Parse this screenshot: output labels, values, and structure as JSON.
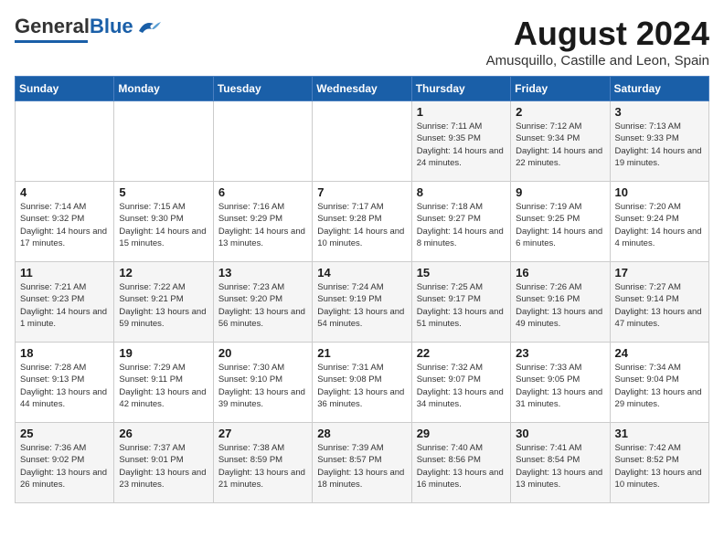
{
  "header": {
    "logo_general": "General",
    "logo_blue": "Blue",
    "month": "August 2024",
    "location": "Amusquillo, Castille and Leon, Spain"
  },
  "weekdays": [
    "Sunday",
    "Monday",
    "Tuesday",
    "Wednesday",
    "Thursday",
    "Friday",
    "Saturday"
  ],
  "weeks": [
    [
      {
        "day": "",
        "info": ""
      },
      {
        "day": "",
        "info": ""
      },
      {
        "day": "",
        "info": ""
      },
      {
        "day": "",
        "info": ""
      },
      {
        "day": "1",
        "info": "Sunrise: 7:11 AM\nSunset: 9:35 PM\nDaylight: 14 hours and 24 minutes."
      },
      {
        "day": "2",
        "info": "Sunrise: 7:12 AM\nSunset: 9:34 PM\nDaylight: 14 hours and 22 minutes."
      },
      {
        "day": "3",
        "info": "Sunrise: 7:13 AM\nSunset: 9:33 PM\nDaylight: 14 hours and 19 minutes."
      }
    ],
    [
      {
        "day": "4",
        "info": "Sunrise: 7:14 AM\nSunset: 9:32 PM\nDaylight: 14 hours and 17 minutes."
      },
      {
        "day": "5",
        "info": "Sunrise: 7:15 AM\nSunset: 9:30 PM\nDaylight: 14 hours and 15 minutes."
      },
      {
        "day": "6",
        "info": "Sunrise: 7:16 AM\nSunset: 9:29 PM\nDaylight: 14 hours and 13 minutes."
      },
      {
        "day": "7",
        "info": "Sunrise: 7:17 AM\nSunset: 9:28 PM\nDaylight: 14 hours and 10 minutes."
      },
      {
        "day": "8",
        "info": "Sunrise: 7:18 AM\nSunset: 9:27 PM\nDaylight: 14 hours and 8 minutes."
      },
      {
        "day": "9",
        "info": "Sunrise: 7:19 AM\nSunset: 9:25 PM\nDaylight: 14 hours and 6 minutes."
      },
      {
        "day": "10",
        "info": "Sunrise: 7:20 AM\nSunset: 9:24 PM\nDaylight: 14 hours and 4 minutes."
      }
    ],
    [
      {
        "day": "11",
        "info": "Sunrise: 7:21 AM\nSunset: 9:23 PM\nDaylight: 14 hours and 1 minute."
      },
      {
        "day": "12",
        "info": "Sunrise: 7:22 AM\nSunset: 9:21 PM\nDaylight: 13 hours and 59 minutes."
      },
      {
        "day": "13",
        "info": "Sunrise: 7:23 AM\nSunset: 9:20 PM\nDaylight: 13 hours and 56 minutes."
      },
      {
        "day": "14",
        "info": "Sunrise: 7:24 AM\nSunset: 9:19 PM\nDaylight: 13 hours and 54 minutes."
      },
      {
        "day": "15",
        "info": "Sunrise: 7:25 AM\nSunset: 9:17 PM\nDaylight: 13 hours and 51 minutes."
      },
      {
        "day": "16",
        "info": "Sunrise: 7:26 AM\nSunset: 9:16 PM\nDaylight: 13 hours and 49 minutes."
      },
      {
        "day": "17",
        "info": "Sunrise: 7:27 AM\nSunset: 9:14 PM\nDaylight: 13 hours and 47 minutes."
      }
    ],
    [
      {
        "day": "18",
        "info": "Sunrise: 7:28 AM\nSunset: 9:13 PM\nDaylight: 13 hours and 44 minutes."
      },
      {
        "day": "19",
        "info": "Sunrise: 7:29 AM\nSunset: 9:11 PM\nDaylight: 13 hours and 42 minutes."
      },
      {
        "day": "20",
        "info": "Sunrise: 7:30 AM\nSunset: 9:10 PM\nDaylight: 13 hours and 39 minutes."
      },
      {
        "day": "21",
        "info": "Sunrise: 7:31 AM\nSunset: 9:08 PM\nDaylight: 13 hours and 36 minutes."
      },
      {
        "day": "22",
        "info": "Sunrise: 7:32 AM\nSunset: 9:07 PM\nDaylight: 13 hours and 34 minutes."
      },
      {
        "day": "23",
        "info": "Sunrise: 7:33 AM\nSunset: 9:05 PM\nDaylight: 13 hours and 31 minutes."
      },
      {
        "day": "24",
        "info": "Sunrise: 7:34 AM\nSunset: 9:04 PM\nDaylight: 13 hours and 29 minutes."
      }
    ],
    [
      {
        "day": "25",
        "info": "Sunrise: 7:36 AM\nSunset: 9:02 PM\nDaylight: 13 hours and 26 minutes."
      },
      {
        "day": "26",
        "info": "Sunrise: 7:37 AM\nSunset: 9:01 PM\nDaylight: 13 hours and 23 minutes."
      },
      {
        "day": "27",
        "info": "Sunrise: 7:38 AM\nSunset: 8:59 PM\nDaylight: 13 hours and 21 minutes."
      },
      {
        "day": "28",
        "info": "Sunrise: 7:39 AM\nSunset: 8:57 PM\nDaylight: 13 hours and 18 minutes."
      },
      {
        "day": "29",
        "info": "Sunrise: 7:40 AM\nSunset: 8:56 PM\nDaylight: 13 hours and 16 minutes."
      },
      {
        "day": "30",
        "info": "Sunrise: 7:41 AM\nSunset: 8:54 PM\nDaylight: 13 hours and 13 minutes."
      },
      {
        "day": "31",
        "info": "Sunrise: 7:42 AM\nSunset: 8:52 PM\nDaylight: 13 hours and 10 minutes."
      }
    ]
  ]
}
